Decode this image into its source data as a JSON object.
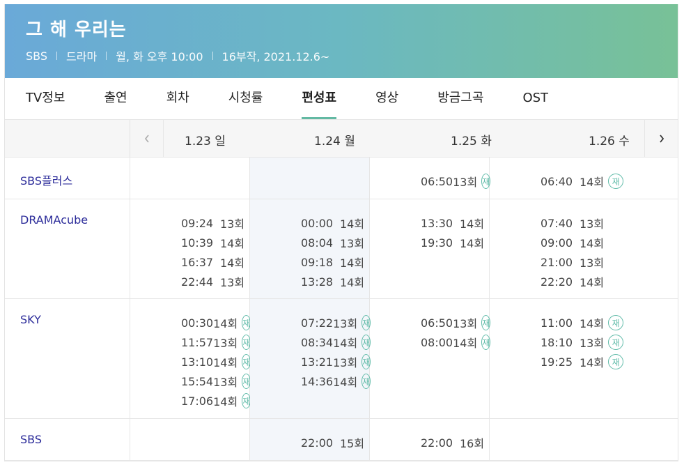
{
  "program": {
    "title": "그 해 우리는",
    "meta": [
      "SBS",
      "드라마",
      "월, 화 오후 10:00",
      "16부작, 2021.12.6~"
    ]
  },
  "tabs": [
    {
      "label": "TV정보",
      "active": false
    },
    {
      "label": "출연",
      "active": false
    },
    {
      "label": "회차",
      "active": false
    },
    {
      "label": "시청률",
      "active": false
    },
    {
      "label": "편성표",
      "active": true
    },
    {
      "label": "영상",
      "active": false
    },
    {
      "label": "방금그곡",
      "active": false
    },
    {
      "label": "OST",
      "active": false
    }
  ],
  "dates": [
    "1.23 일",
    "1.24 월",
    "1.25 화",
    "1.26 수"
  ],
  "rerun_badge": "재",
  "schedule": [
    {
      "channel": "SBS플러스",
      "days": [
        [],
        [],
        [
          {
            "time": "06:50",
            "ep": "13회",
            "rerun": true
          }
        ],
        [
          {
            "time": "06:40",
            "ep": "14회",
            "rerun": true
          }
        ]
      ]
    },
    {
      "channel": "DRAMAcube",
      "days": [
        [
          {
            "time": "09:24",
            "ep": "13회",
            "rerun": false
          },
          {
            "time": "10:39",
            "ep": "14회",
            "rerun": false
          },
          {
            "time": "16:37",
            "ep": "14회",
            "rerun": false
          },
          {
            "time": "22:44",
            "ep": "13회",
            "rerun": false
          }
        ],
        [
          {
            "time": "00:00",
            "ep": "14회",
            "rerun": false
          },
          {
            "time": "08:04",
            "ep": "13회",
            "rerun": false
          },
          {
            "time": "09:18",
            "ep": "14회",
            "rerun": false
          },
          {
            "time": "13:28",
            "ep": "14회",
            "rerun": false
          }
        ],
        [
          {
            "time": "13:30",
            "ep": "14회",
            "rerun": false
          },
          {
            "time": "19:30",
            "ep": "14회",
            "rerun": false
          }
        ],
        [
          {
            "time": "07:40",
            "ep": "13회",
            "rerun": false
          },
          {
            "time": "09:00",
            "ep": "14회",
            "rerun": false
          },
          {
            "time": "21:00",
            "ep": "13회",
            "rerun": false
          },
          {
            "time": "22:20",
            "ep": "14회",
            "rerun": false
          }
        ]
      ]
    },
    {
      "channel": "SKY",
      "days": [
        [
          {
            "time": "00:30",
            "ep": "14회",
            "rerun": true
          },
          {
            "time": "11:57",
            "ep": "13회",
            "rerun": true
          },
          {
            "time": "13:10",
            "ep": "14회",
            "rerun": true
          },
          {
            "time": "15:54",
            "ep": "13회",
            "rerun": true
          },
          {
            "time": "17:06",
            "ep": "14회",
            "rerun": true
          }
        ],
        [
          {
            "time": "07:22",
            "ep": "13회",
            "rerun": true
          },
          {
            "time": "08:34",
            "ep": "14회",
            "rerun": true
          },
          {
            "time": "13:21",
            "ep": "13회",
            "rerun": true
          },
          {
            "time": "14:36",
            "ep": "14회",
            "rerun": true
          }
        ],
        [
          {
            "time": "06:50",
            "ep": "13회",
            "rerun": true
          },
          {
            "time": "08:00",
            "ep": "14회",
            "rerun": true
          }
        ],
        [
          {
            "time": "11:00",
            "ep": "14회",
            "rerun": true
          },
          {
            "time": "18:10",
            "ep": "13회",
            "rerun": true
          },
          {
            "time": "19:25",
            "ep": "14회",
            "rerun": true
          }
        ]
      ]
    },
    {
      "channel": "SBS",
      "days": [
        [],
        [
          {
            "time": "22:00",
            "ep": "15회",
            "rerun": false
          }
        ],
        [
          {
            "time": "22:00",
            "ep": "16회",
            "rerun": false
          }
        ],
        []
      ]
    }
  ],
  "icons": {
    "prev": "chevron-left-icon",
    "next": "chevron-right-icon"
  },
  "colors": {
    "accent": "#63b9a3",
    "channel_link": "#2c2c9a",
    "header_start": "#6aa9d8",
    "header_end": "#78c197"
  }
}
